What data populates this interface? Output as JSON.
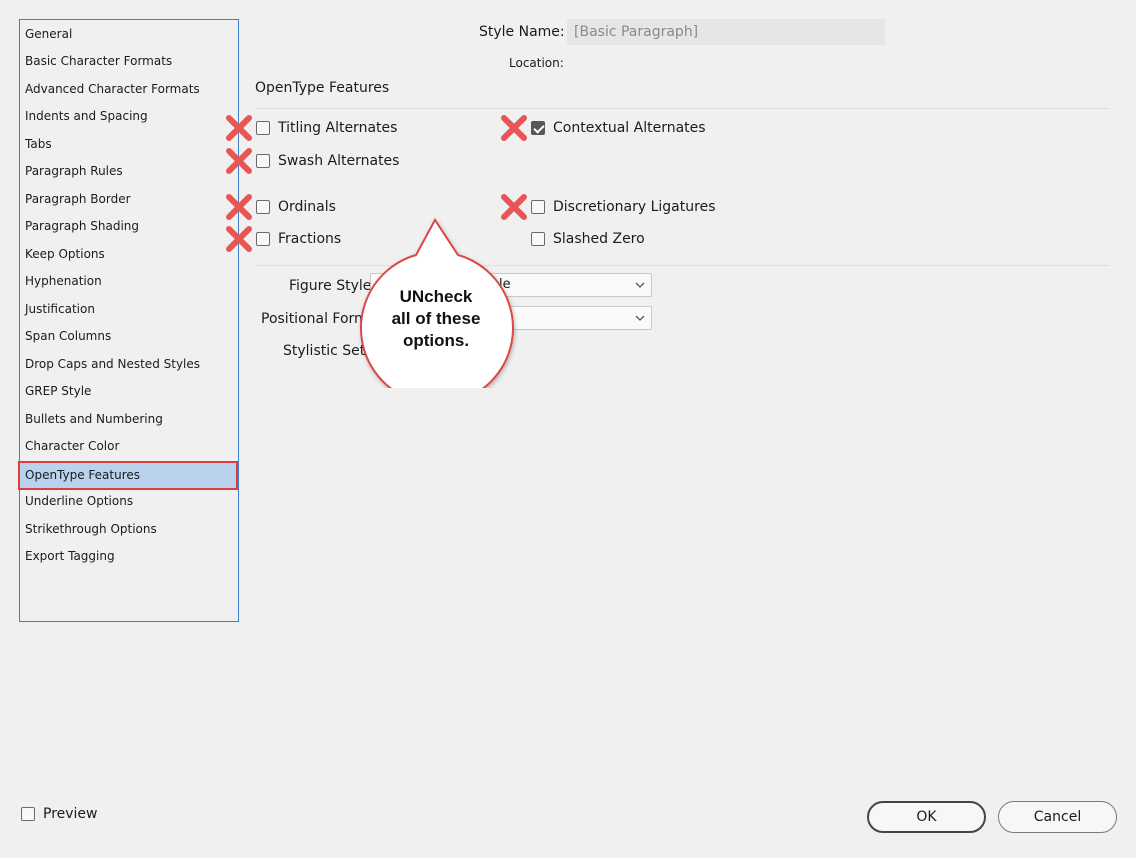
{
  "sidebar": {
    "items": [
      {
        "label": "General"
      },
      {
        "label": "Basic Character Formats"
      },
      {
        "label": "Advanced Character Formats"
      },
      {
        "label": "Indents and Spacing"
      },
      {
        "label": "Tabs"
      },
      {
        "label": "Paragraph Rules"
      },
      {
        "label": "Paragraph Border"
      },
      {
        "label": "Paragraph Shading"
      },
      {
        "label": "Keep Options"
      },
      {
        "label": "Hyphenation"
      },
      {
        "label": "Justification"
      },
      {
        "label": "Span Columns"
      },
      {
        "label": "Drop Caps and Nested Styles"
      },
      {
        "label": "GREP Style"
      },
      {
        "label": "Bullets and Numbering"
      },
      {
        "label": "Character Color"
      },
      {
        "label": "OpenType Features",
        "selected": true
      },
      {
        "label": "Underline Options"
      },
      {
        "label": "Strikethrough Options"
      },
      {
        "label": "Export Tagging"
      }
    ]
  },
  "header": {
    "style_name_label": "Style Name:",
    "style_name_value": "[Basic Paragraph]",
    "location_label": "Location:"
  },
  "section": {
    "title": "OpenType Features"
  },
  "options": {
    "titling_alternates": {
      "label": "Titling Alternates",
      "checked": false
    },
    "contextual_alternates": {
      "label": "Contextual Alternates",
      "checked": true
    },
    "swash_alternates": {
      "label": "Swash Alternates",
      "checked": false
    },
    "ordinals": {
      "label": "Ordinals",
      "checked": false
    },
    "discretionary_ligatures": {
      "label": "Discretionary Ligatures",
      "checked": false
    },
    "fractions": {
      "label": "Fractions",
      "checked": false
    },
    "slashed_zero": {
      "label": "Slashed Zero",
      "checked": false
    }
  },
  "fields": {
    "figure_style_label": "Figure Style:",
    "figure_style_value": "le",
    "positional_form_label": "Positional Form",
    "positional_form_value": "",
    "stylistic_sets_label": "Stylistic Sets:"
  },
  "callout": {
    "line1": "UNcheck",
    "line2": "all of these",
    "line3": "options.",
    "border_color": "#d94848"
  },
  "footer": {
    "preview_label": "Preview",
    "preview_checked": false,
    "ok_label": "OK",
    "cancel_label": "Cancel"
  },
  "colors": {
    "accent": "#3d80d1",
    "selection": "#b9d3ee",
    "highlight_border": "#e03c3c",
    "x_mark": "#e85555"
  }
}
